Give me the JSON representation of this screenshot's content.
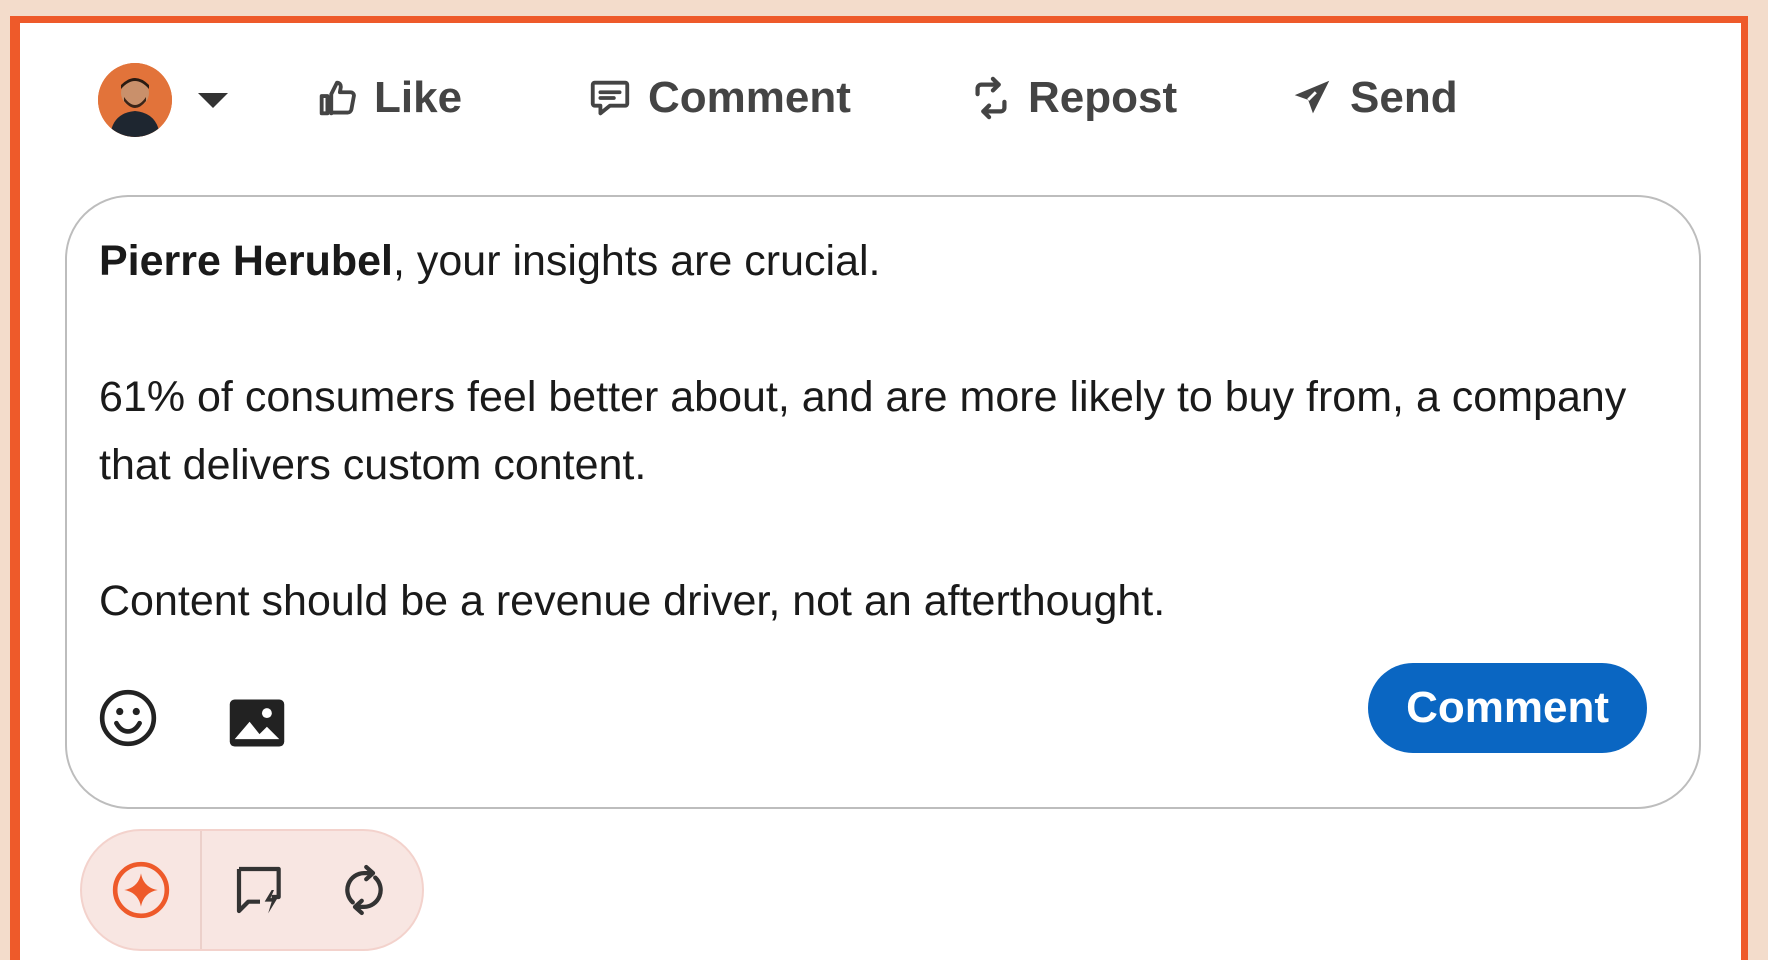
{
  "actions": {
    "like": "Like",
    "comment": "Comment",
    "repost": "Repost",
    "send": "Send"
  },
  "editor": {
    "mention": "Pierre Herubel",
    "line1_rest": ", your insights are crucial.",
    "paragraph2": "61% of consumers feel better about, and are more likely to buy from, a company that delivers custom content.",
    "paragraph3": "Content should be a revenue driver, not an afterthought.",
    "submit_label": "Comment"
  },
  "colors": {
    "accent": "#ee5a2a",
    "primary_button": "#0a66c2",
    "text": "#1a1a1a",
    "icon": "#444444"
  },
  "icons": {
    "avatar_menu": "chevron-down-icon",
    "like": "thumbs-up-icon",
    "comment": "speech-bubble-icon",
    "repost": "repost-arrows-icon",
    "send": "paper-plane-icon",
    "emoji": "emoji-icon",
    "image": "image-icon",
    "ext_ai": "sparkle-icon",
    "ext_comment": "comment-bolt-icon",
    "ext_repost": "refresh-icon"
  }
}
